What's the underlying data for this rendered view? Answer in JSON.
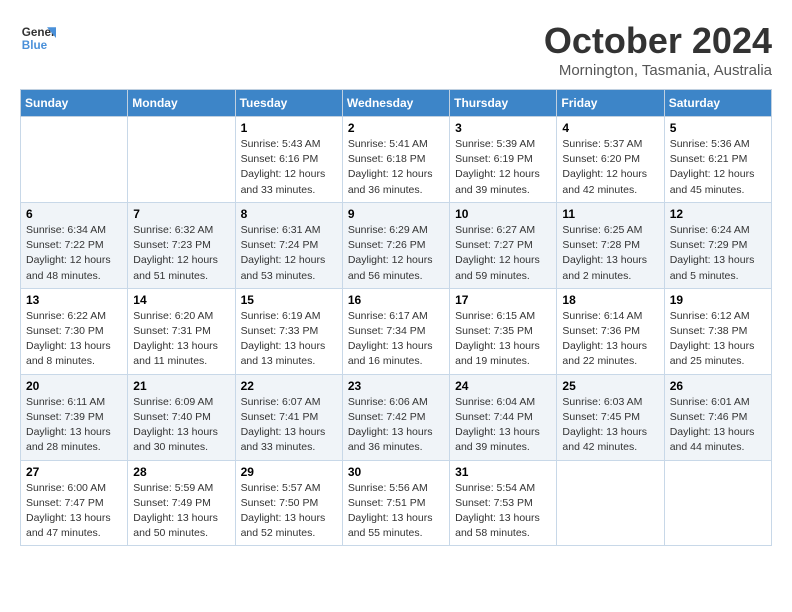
{
  "logo": {
    "line1": "General",
    "line2": "Blue"
  },
  "title": "October 2024",
  "location": "Mornington, Tasmania, Australia",
  "weekdays": [
    "Sunday",
    "Monday",
    "Tuesday",
    "Wednesday",
    "Thursday",
    "Friday",
    "Saturday"
  ],
  "weeks": [
    [
      {
        "day": "",
        "info": ""
      },
      {
        "day": "",
        "info": ""
      },
      {
        "day": "1",
        "info": "Sunrise: 5:43 AM\nSunset: 6:16 PM\nDaylight: 12 hours\nand 33 minutes."
      },
      {
        "day": "2",
        "info": "Sunrise: 5:41 AM\nSunset: 6:18 PM\nDaylight: 12 hours\nand 36 minutes."
      },
      {
        "day": "3",
        "info": "Sunrise: 5:39 AM\nSunset: 6:19 PM\nDaylight: 12 hours\nand 39 minutes."
      },
      {
        "day": "4",
        "info": "Sunrise: 5:37 AM\nSunset: 6:20 PM\nDaylight: 12 hours\nand 42 minutes."
      },
      {
        "day": "5",
        "info": "Sunrise: 5:36 AM\nSunset: 6:21 PM\nDaylight: 12 hours\nand 45 minutes."
      }
    ],
    [
      {
        "day": "6",
        "info": "Sunrise: 6:34 AM\nSunset: 7:22 PM\nDaylight: 12 hours\nand 48 minutes."
      },
      {
        "day": "7",
        "info": "Sunrise: 6:32 AM\nSunset: 7:23 PM\nDaylight: 12 hours\nand 51 minutes."
      },
      {
        "day": "8",
        "info": "Sunrise: 6:31 AM\nSunset: 7:24 PM\nDaylight: 12 hours\nand 53 minutes."
      },
      {
        "day": "9",
        "info": "Sunrise: 6:29 AM\nSunset: 7:26 PM\nDaylight: 12 hours\nand 56 minutes."
      },
      {
        "day": "10",
        "info": "Sunrise: 6:27 AM\nSunset: 7:27 PM\nDaylight: 12 hours\nand 59 minutes."
      },
      {
        "day": "11",
        "info": "Sunrise: 6:25 AM\nSunset: 7:28 PM\nDaylight: 13 hours\nand 2 minutes."
      },
      {
        "day": "12",
        "info": "Sunrise: 6:24 AM\nSunset: 7:29 PM\nDaylight: 13 hours\nand 5 minutes."
      }
    ],
    [
      {
        "day": "13",
        "info": "Sunrise: 6:22 AM\nSunset: 7:30 PM\nDaylight: 13 hours\nand 8 minutes."
      },
      {
        "day": "14",
        "info": "Sunrise: 6:20 AM\nSunset: 7:31 PM\nDaylight: 13 hours\nand 11 minutes."
      },
      {
        "day": "15",
        "info": "Sunrise: 6:19 AM\nSunset: 7:33 PM\nDaylight: 13 hours\nand 13 minutes."
      },
      {
        "day": "16",
        "info": "Sunrise: 6:17 AM\nSunset: 7:34 PM\nDaylight: 13 hours\nand 16 minutes."
      },
      {
        "day": "17",
        "info": "Sunrise: 6:15 AM\nSunset: 7:35 PM\nDaylight: 13 hours\nand 19 minutes."
      },
      {
        "day": "18",
        "info": "Sunrise: 6:14 AM\nSunset: 7:36 PM\nDaylight: 13 hours\nand 22 minutes."
      },
      {
        "day": "19",
        "info": "Sunrise: 6:12 AM\nSunset: 7:38 PM\nDaylight: 13 hours\nand 25 minutes."
      }
    ],
    [
      {
        "day": "20",
        "info": "Sunrise: 6:11 AM\nSunset: 7:39 PM\nDaylight: 13 hours\nand 28 minutes."
      },
      {
        "day": "21",
        "info": "Sunrise: 6:09 AM\nSunset: 7:40 PM\nDaylight: 13 hours\nand 30 minutes."
      },
      {
        "day": "22",
        "info": "Sunrise: 6:07 AM\nSunset: 7:41 PM\nDaylight: 13 hours\nand 33 minutes."
      },
      {
        "day": "23",
        "info": "Sunrise: 6:06 AM\nSunset: 7:42 PM\nDaylight: 13 hours\nand 36 minutes."
      },
      {
        "day": "24",
        "info": "Sunrise: 6:04 AM\nSunset: 7:44 PM\nDaylight: 13 hours\nand 39 minutes."
      },
      {
        "day": "25",
        "info": "Sunrise: 6:03 AM\nSunset: 7:45 PM\nDaylight: 13 hours\nand 42 minutes."
      },
      {
        "day": "26",
        "info": "Sunrise: 6:01 AM\nSunset: 7:46 PM\nDaylight: 13 hours\nand 44 minutes."
      }
    ],
    [
      {
        "day": "27",
        "info": "Sunrise: 6:00 AM\nSunset: 7:47 PM\nDaylight: 13 hours\nand 47 minutes."
      },
      {
        "day": "28",
        "info": "Sunrise: 5:59 AM\nSunset: 7:49 PM\nDaylight: 13 hours\nand 50 minutes."
      },
      {
        "day": "29",
        "info": "Sunrise: 5:57 AM\nSunset: 7:50 PM\nDaylight: 13 hours\nand 52 minutes."
      },
      {
        "day": "30",
        "info": "Sunrise: 5:56 AM\nSunset: 7:51 PM\nDaylight: 13 hours\nand 55 minutes."
      },
      {
        "day": "31",
        "info": "Sunrise: 5:54 AM\nSunset: 7:53 PM\nDaylight: 13 hours\nand 58 minutes."
      },
      {
        "day": "",
        "info": ""
      },
      {
        "day": "",
        "info": ""
      }
    ]
  ]
}
